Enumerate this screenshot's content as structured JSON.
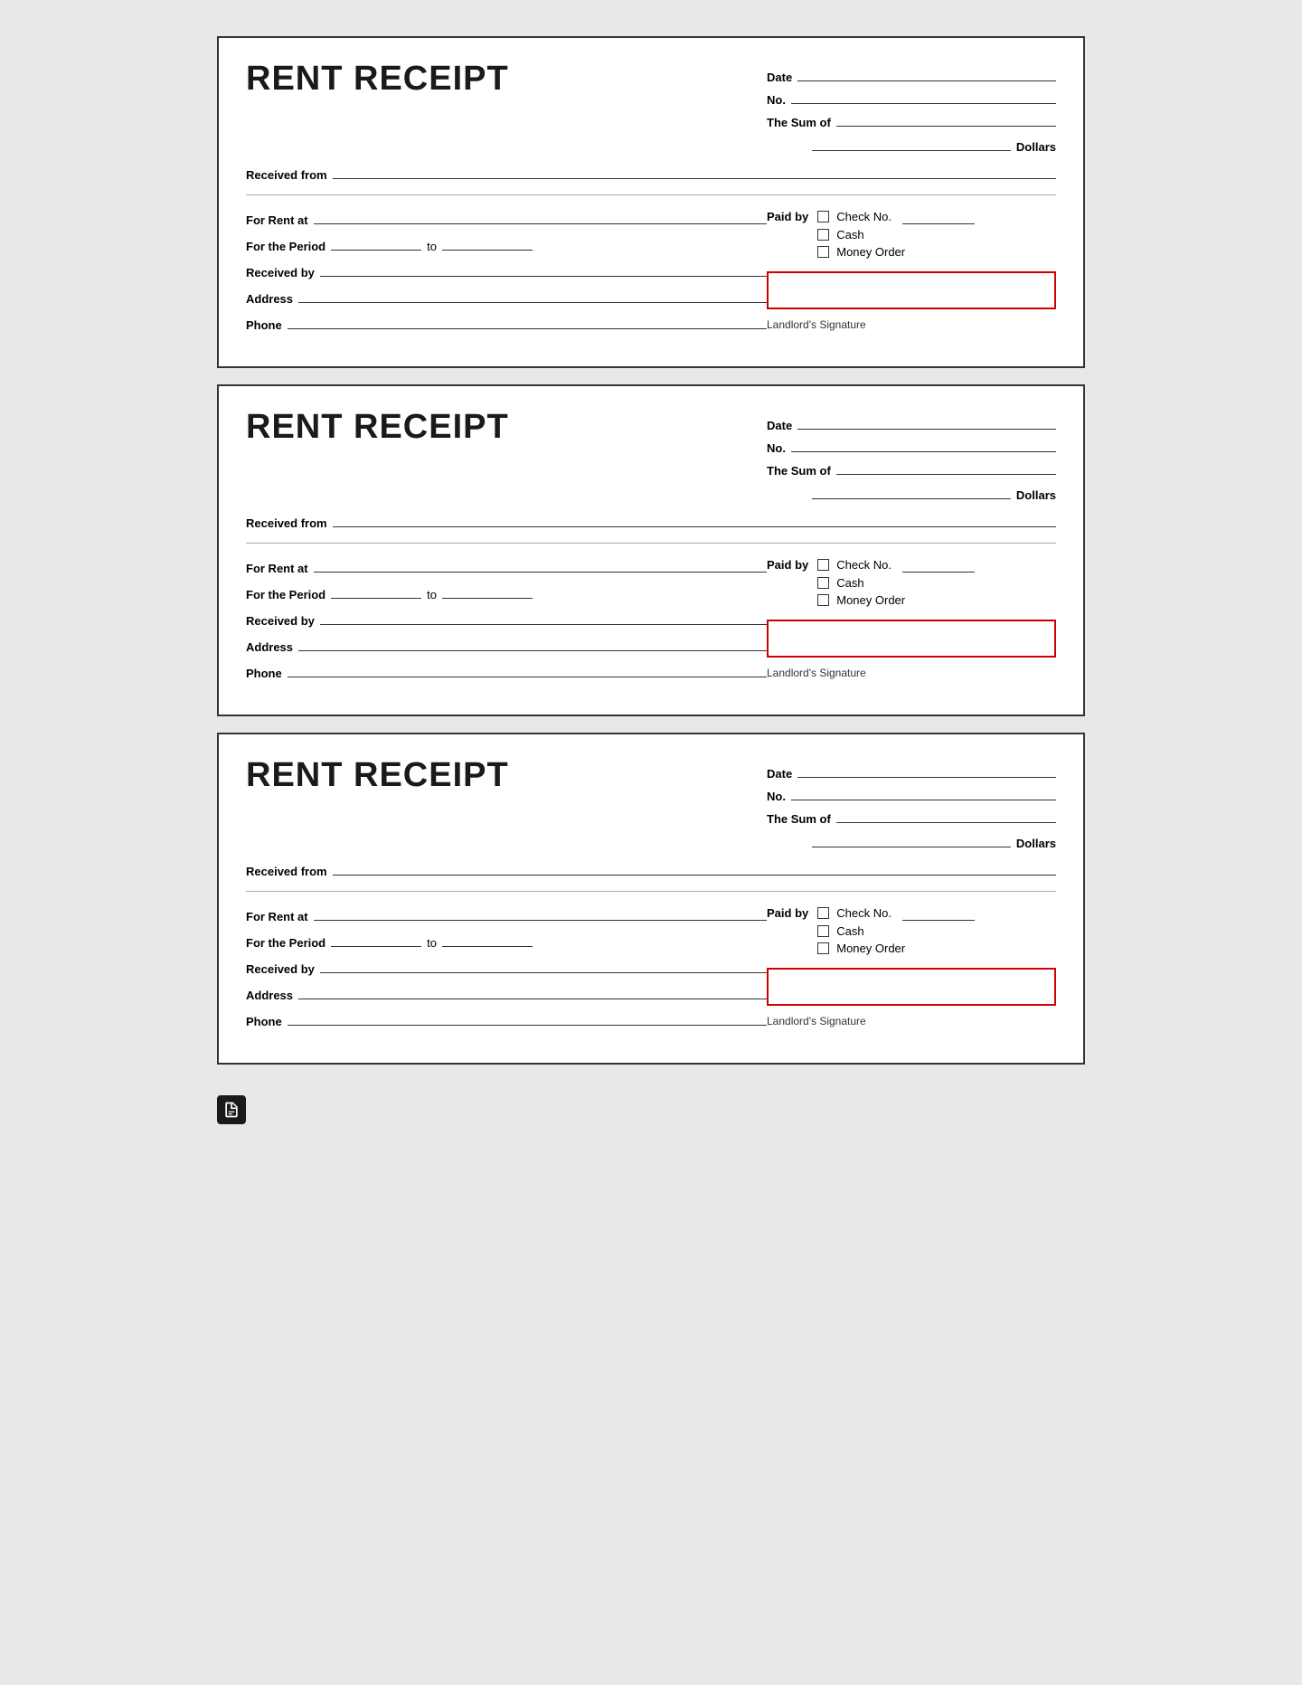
{
  "receipts": [
    {
      "id": 1,
      "title": "RENT RECEIPT",
      "date_label": "Date",
      "no_label": "No.",
      "sum_label": "The Sum of",
      "dollars_label": "Dollars",
      "received_from_label": "Received from",
      "for_rent_at_label": "For Rent at",
      "paid_by_label": "Paid by",
      "for_period_label": "For the Period",
      "to_label": "to",
      "received_by_label": "Received by",
      "address_label": "Address",
      "phone_label": "Phone",
      "check_no_label": "Check No.",
      "cash_label": "Cash",
      "money_order_label": "Money Order",
      "landlord_signature_label": "Landlord's Signature"
    },
    {
      "id": 2,
      "title": "RENT RECEIPT",
      "date_label": "Date",
      "no_label": "No.",
      "sum_label": "The Sum of",
      "dollars_label": "Dollars",
      "received_from_label": "Received from",
      "for_rent_at_label": "For Rent at",
      "paid_by_label": "Paid by",
      "for_period_label": "For the Period",
      "to_label": "to",
      "received_by_label": "Received by",
      "address_label": "Address",
      "phone_label": "Phone",
      "check_no_label": "Check No.",
      "cash_label": "Cash",
      "money_order_label": "Money Order",
      "landlord_signature_label": "Landlord's Signature"
    },
    {
      "id": 3,
      "title": "RENT RECEIPT",
      "date_label": "Date",
      "no_label": "No.",
      "sum_label": "The Sum of",
      "dollars_label": "Dollars",
      "received_from_label": "Received from",
      "for_rent_at_label": "For Rent at",
      "paid_by_label": "Paid by",
      "for_period_label": "For the Period",
      "to_label": "to",
      "received_by_label": "Received by",
      "address_label": "Address",
      "phone_label": "Phone",
      "check_no_label": "Check No.",
      "cash_label": "Cash",
      "money_order_label": "Money Order",
      "landlord_signature_label": "Landlord's Signature"
    }
  ],
  "bottom_icon": "document-icon"
}
